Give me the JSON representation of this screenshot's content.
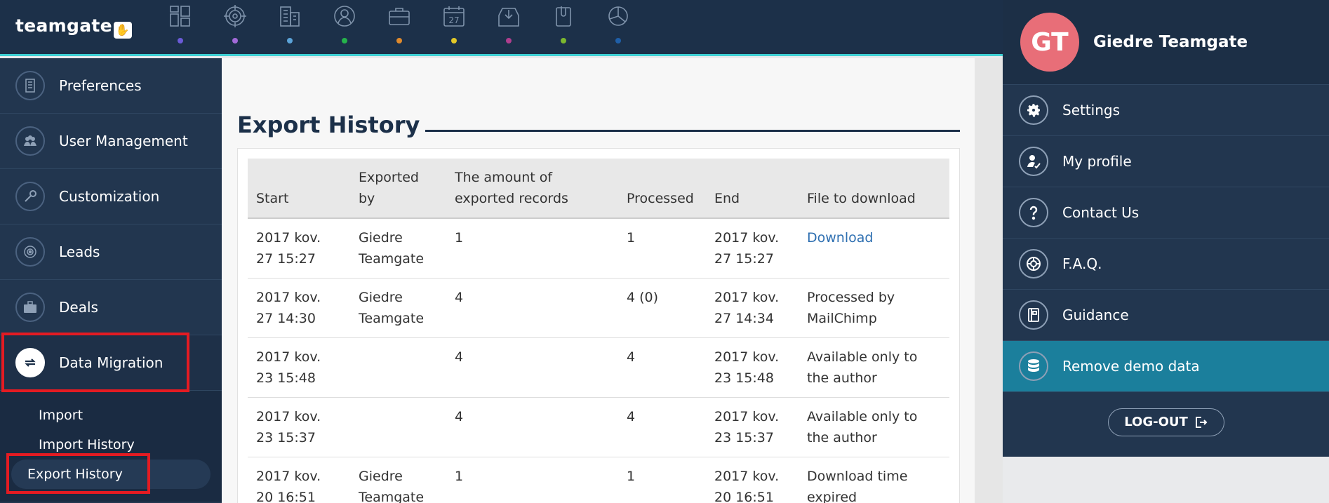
{
  "app": {
    "logo_text": "teamgate",
    "logo_hand": "✋"
  },
  "topnav": {
    "icons": [
      {
        "name": "dashboard-icon",
        "dot": "#6b5bd8"
      },
      {
        "name": "target-icon",
        "dot": "#a26ad8"
      },
      {
        "name": "buildings-icon",
        "dot": "#5ba3d8"
      },
      {
        "name": "contacts-icon",
        "dot": "#25b34b"
      },
      {
        "name": "deals-briefcase-icon",
        "dot": "#e08a2c"
      },
      {
        "name": "calendar-icon",
        "dot": "#e2c828"
      },
      {
        "name": "inbox-icon",
        "dot": "#b03e8e"
      },
      {
        "name": "attachment-icon",
        "dot": "#7cb82f"
      },
      {
        "name": "reports-pie-icon",
        "dot": "#1f5fa8"
      }
    ],
    "calendar_number": "27"
  },
  "sidebar": {
    "items": [
      {
        "label": "Preferences",
        "icon": "building-icon"
      },
      {
        "label": "User Management",
        "icon": "users-icon"
      },
      {
        "label": "Customization",
        "icon": "wrench-icon"
      },
      {
        "label": "Leads",
        "icon": "target-icon"
      },
      {
        "label": "Deals",
        "icon": "briefcase-icon"
      },
      {
        "label": "Data Migration",
        "icon": "sync-icon"
      }
    ],
    "sub_items": [
      "Import",
      "Import History",
      "Export History"
    ]
  },
  "main": {
    "title": "Export History",
    "table": {
      "headers": [
        "Start",
        "Exported by",
        "The amount of exported records",
        "Processed",
        "End",
        "File to download"
      ],
      "rows": [
        {
          "start": "2017 kov. 27 15:27",
          "by": "Giedre Teamgate",
          "amount": "1",
          "processed": "1",
          "end": "2017 kov. 27 15:27",
          "file": "Download",
          "is_link": true
        },
        {
          "start": "2017 kov. 27 14:30",
          "by": "Giedre Teamgate",
          "amount": "4",
          "processed": "4 (0)",
          "end": "2017 kov. 27 14:34",
          "file": "Processed by MailChimp",
          "is_link": false
        },
        {
          "start": "2017 kov. 23 15:48",
          "by": "",
          "amount": "4",
          "processed": "4",
          "end": "2017 kov. 23 15:48",
          "file": "Available only to the author",
          "is_link": false
        },
        {
          "start": "2017 kov. 23 15:37",
          "by": "",
          "amount": "4",
          "processed": "4",
          "end": "2017 kov. 23 15:37",
          "file": "Available only to the author",
          "is_link": false
        },
        {
          "start": "2017 kov. 20 16:51",
          "by": "Giedre Teamgate",
          "amount": "1",
          "processed": "1",
          "end": "2017 kov. 20 16:51",
          "file": "Download time expired",
          "is_link": false
        }
      ]
    }
  },
  "profile": {
    "initials": "GT",
    "name": "Giedre Teamgate",
    "menu": [
      {
        "label": "Settings",
        "icon": "gear-icon"
      },
      {
        "label": "My profile",
        "icon": "user-profile-icon"
      },
      {
        "label": "Contact Us",
        "icon": "question-icon"
      },
      {
        "label": "F.A.Q.",
        "icon": "lifebuoy-icon"
      },
      {
        "label": "Guidance",
        "icon": "guide-book-icon"
      },
      {
        "label": "Remove demo data",
        "icon": "database-icon"
      }
    ],
    "logout_label": "LOG-OUT"
  },
  "colors": {
    "accent_teal": "#3fd0d4",
    "highlight_red": "#e41b22",
    "link_blue": "#2e6fb1",
    "avatar_pink": "#e86e78",
    "remove_demo_bg": "#1b7f9c"
  }
}
